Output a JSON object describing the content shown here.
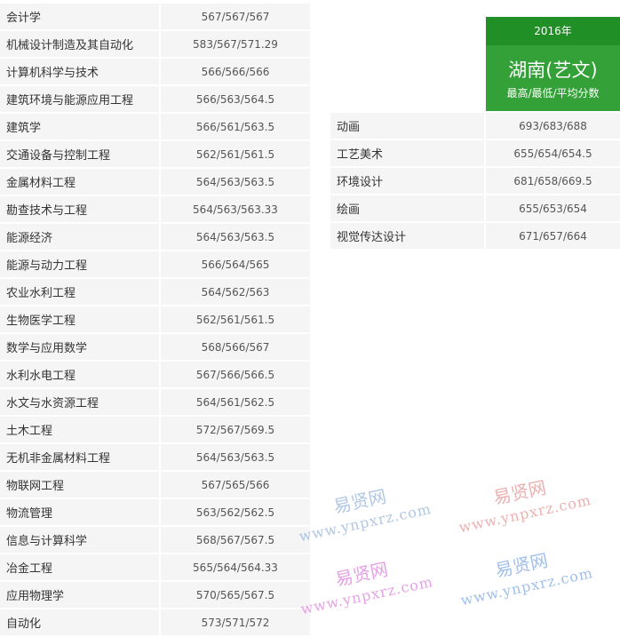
{
  "left_rows": [
    {
      "major": "会计学",
      "score": "567/567/567"
    },
    {
      "major": "机械设计制造及其自动化",
      "score": "583/567/571.29"
    },
    {
      "major": "计算机科学与技术",
      "score": "566/566/566"
    },
    {
      "major": "建筑环境与能源应用工程",
      "score": "566/563/564.5"
    },
    {
      "major": "建筑学",
      "score": "566/561/563.5"
    },
    {
      "major": "交通设备与控制工程",
      "score": "562/561/561.5"
    },
    {
      "major": "金属材料工程",
      "score": "564/563/563.5"
    },
    {
      "major": "勘查技术与工程",
      "score": "564/563/563.33"
    },
    {
      "major": "能源经济",
      "score": "564/563/563.5"
    },
    {
      "major": "能源与动力工程",
      "score": "566/564/565"
    },
    {
      "major": "农业水利工程",
      "score": "564/562/563"
    },
    {
      "major": "生物医学工程",
      "score": "562/561/561.5"
    },
    {
      "major": "数学与应用数学",
      "score": "568/566/567"
    },
    {
      "major": "水利水电工程",
      "score": "567/566/566.5"
    },
    {
      "major": "水文与水资源工程",
      "score": "564/561/562.5"
    },
    {
      "major": "土木工程",
      "score": "572/567/569.5"
    },
    {
      "major": "无机非金属材料工程",
      "score": "564/563/563.5"
    },
    {
      "major": "物联网工程",
      "score": "567/565/566"
    },
    {
      "major": "物流管理",
      "score": "563/562/562.5"
    },
    {
      "major": "信息与计算科学",
      "score": "568/567/567.5"
    },
    {
      "major": "冶金工程",
      "score": "565/564/564.33"
    },
    {
      "major": "应用物理学",
      "score": "570/565/567.5"
    },
    {
      "major": "自动化",
      "score": "573/571/572"
    }
  ],
  "header": {
    "year": "2016年",
    "title": "湖南(艺文)",
    "subtitle": "最高/最低/平均分数"
  },
  "right_rows": [
    {
      "major": "动画",
      "score": "693/683/688"
    },
    {
      "major": "工艺美术",
      "score": "655/654/654.5"
    },
    {
      "major": "环境设计",
      "score": "681/658/669.5"
    },
    {
      "major": "绘画",
      "score": "655/653/654"
    },
    {
      "major": "视觉传达设计",
      "score": "671/657/664"
    }
  ],
  "watermark": {
    "name": "易贤网",
    "url": "www.ynpxrz.com"
  }
}
